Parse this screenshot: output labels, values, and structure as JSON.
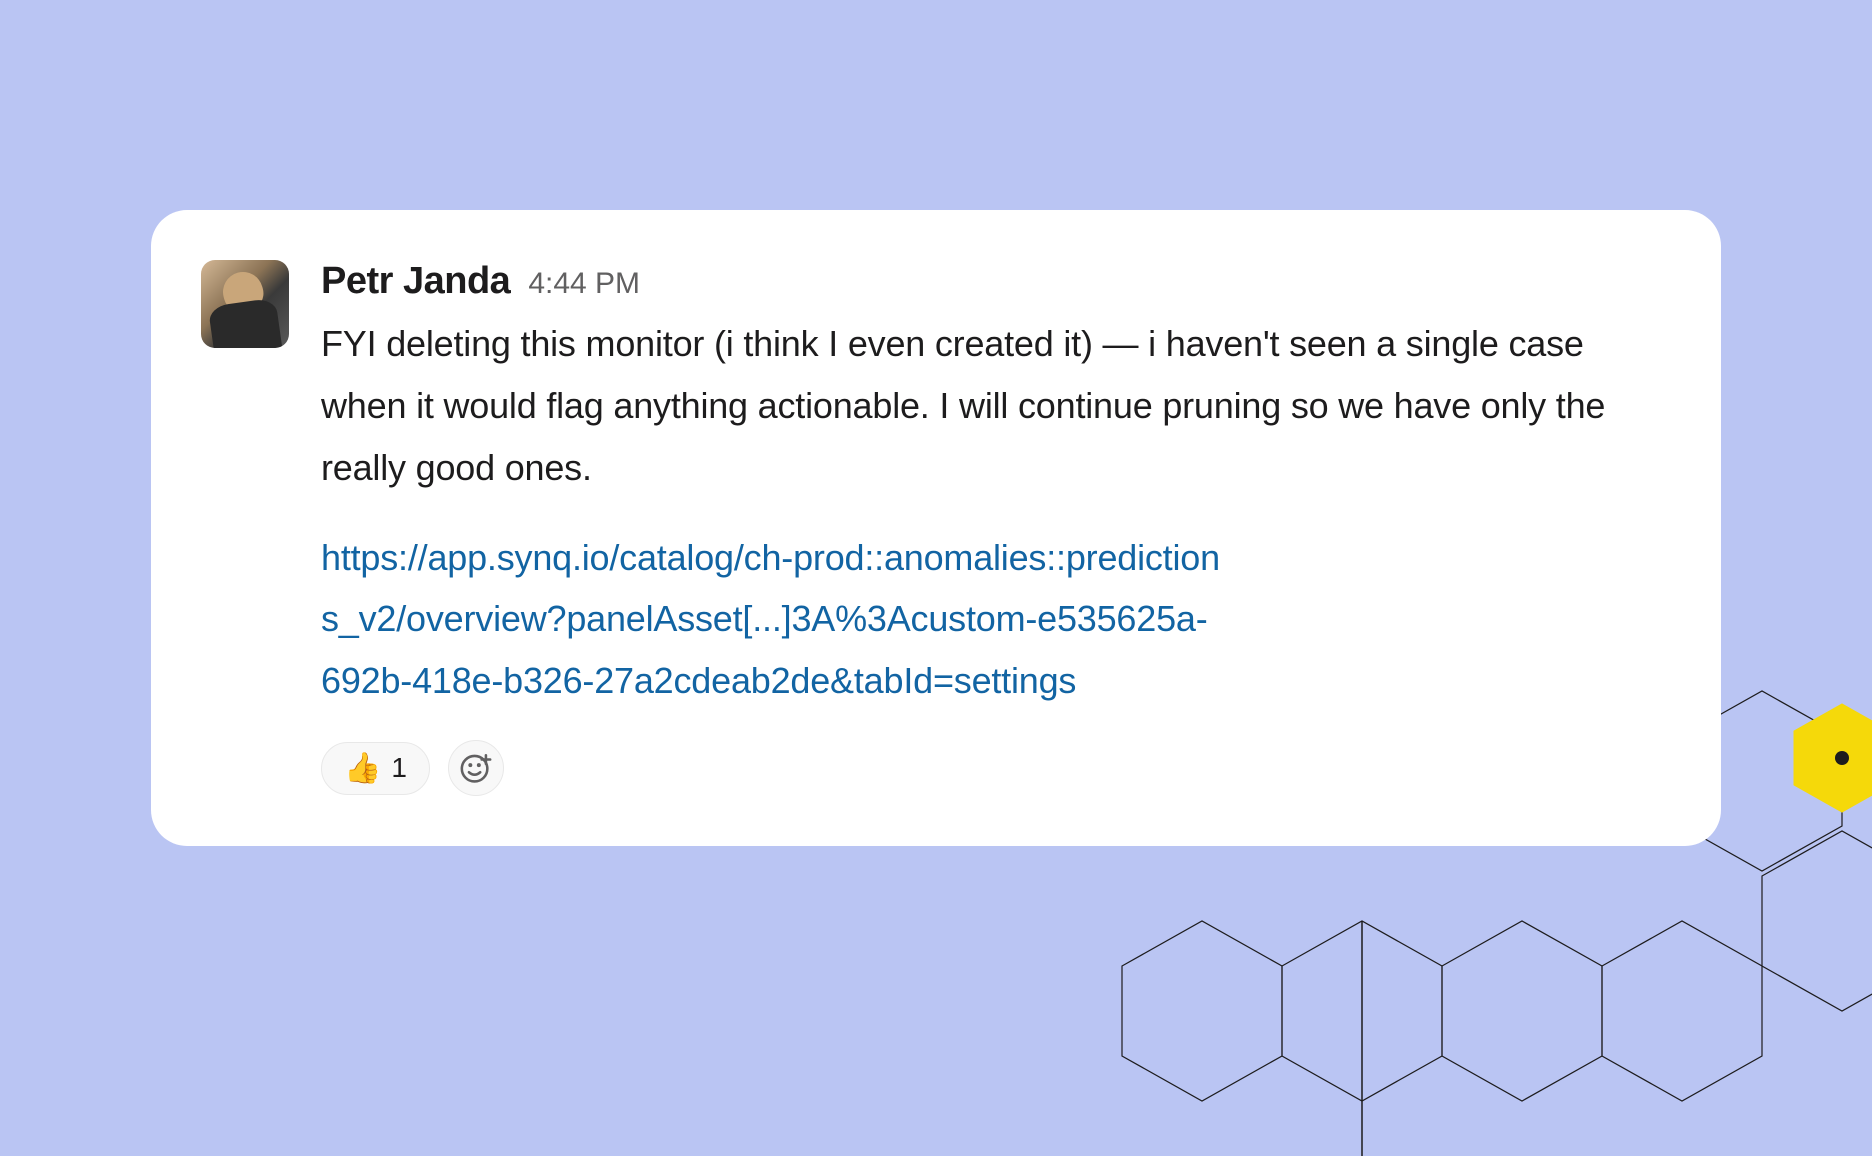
{
  "message": {
    "author": "Petr Janda",
    "timestamp": "4:44 PM",
    "body": "FYI deleting this monitor (i think I even created it) — i haven't seen a single case when it would flag anything actionable. I will continue pruning so we have only the really good ones.",
    "link": "https://app.synq.io/catalog/ch-prod::anomalies::predictions_v2/overview?panelAsset[...]3A%3Acustom-e535625a-692b-418e-b326-27a2cdeab2de&tabId=settings"
  },
  "reactions": [
    {
      "emoji": "👍",
      "count": "1"
    }
  ]
}
